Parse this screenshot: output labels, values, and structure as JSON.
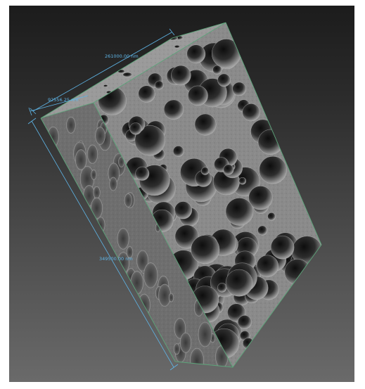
{
  "viewport": {
    "background_top": "#1c1c1c",
    "background_bottom": "#6a6a6a"
  },
  "volume": {
    "edge_color": "#5ca57a",
    "front_face_tone": "#8a8a8a",
    "side_face_tone": "#6e6e6e",
    "top_face_tone": "#9a9a9a",
    "pore_tone": "#141414"
  },
  "dimensions": {
    "color": "#5fb6e8",
    "width_label": "261000.00 nm",
    "depth_label": "92556.25 nm",
    "height_label": "349500.00 nm"
  }
}
